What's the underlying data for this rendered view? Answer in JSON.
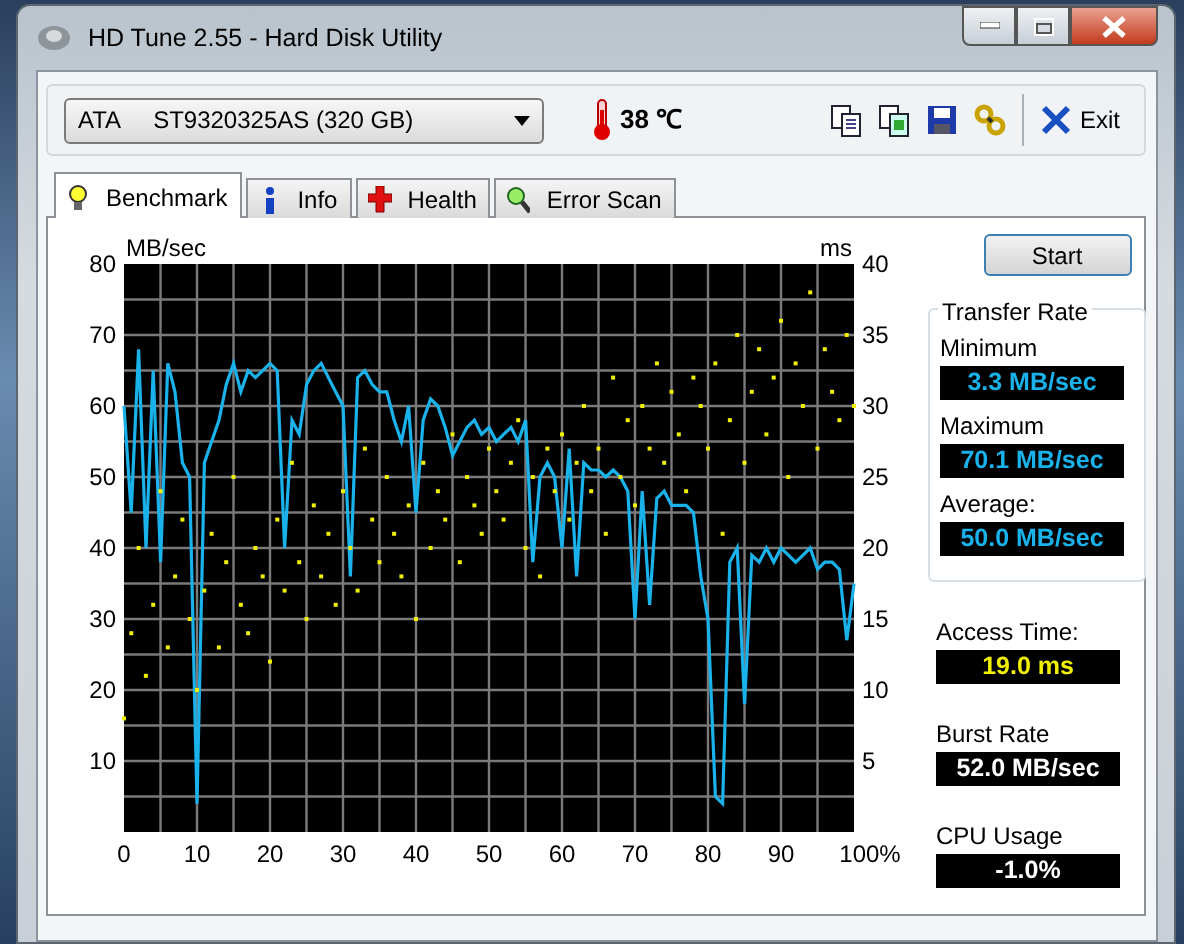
{
  "window": {
    "title": "HD Tune 2.55 - Hard Disk Utility"
  },
  "drive_select": {
    "value": "ATA     ST9320325AS (320 GB)"
  },
  "temperature": "38 ℃",
  "toolbar": [
    {
      "kind": "copy"
    },
    {
      "kind": "copy-color"
    },
    {
      "kind": "save"
    },
    {
      "kind": "options"
    },
    {
      "kind": "exit",
      "label": "Exit"
    }
  ],
  "tabs": [
    {
      "label": "Benchmark",
      "kind": "bulb",
      "selected": true
    },
    {
      "label": "Info",
      "kind": "info",
      "selected": false
    },
    {
      "label": "Health",
      "kind": "cross",
      "selected": false
    },
    {
      "label": "Error Scan",
      "kind": "magnifier",
      "selected": false
    }
  ],
  "transfer_chart": {
    "chart_data": {
      "type": "line",
      "ylabel": "MB/sec",
      "xlim": [
        0,
        100
      ],
      "ylim": [
        0,
        80
      ],
      "grid": true,
      "xticks": [
        0,
        10,
        20,
        30,
        40,
        50,
        60,
        70,
        80,
        90,
        {
          "value": 100,
          "label": "100%"
        }
      ],
      "yticks": [
        10,
        20,
        30,
        40,
        50,
        60,
        70,
        80
      ],
      "x": [
        0,
        1,
        2,
        3,
        4,
        5,
        6,
        7,
        8,
        9,
        10,
        11,
        12,
        13,
        14,
        15,
        16,
        17,
        18,
        19,
        20,
        21,
        22,
        23,
        24,
        25,
        26,
        27,
        28,
        29,
        30,
        31,
        32,
        33,
        34,
        35,
        36,
        37,
        38,
        39,
        40,
        41,
        42,
        43,
        44,
        45,
        46,
        47,
        48,
        49,
        50,
        51,
        52,
        53,
        54,
        55,
        56,
        57,
        58,
        59,
        60,
        61,
        62,
        63,
        64,
        65,
        66,
        67,
        68,
        69,
        70,
        71,
        72,
        73,
        74,
        75,
        76,
        77,
        78,
        79,
        80,
        81,
        82,
        83,
        84,
        85,
        86,
        87,
        88,
        89,
        90,
        91,
        92,
        93,
        94,
        95,
        96,
        97,
        98,
        99,
        100
      ],
      "series": [
        {
          "color": "#1ab2ea",
          "values": [
            60,
            45,
            68,
            40,
            65,
            38,
            66,
            62,
            52,
            50,
            4,
            52,
            55,
            58,
            63,
            66,
            62,
            65,
            64,
            65,
            66,
            65,
            40,
            58,
            56,
            63,
            65,
            66,
            64,
            62,
            60,
            36,
            64,
            65,
            63,
            62,
            62,
            58,
            55,
            60,
            45,
            58,
            61,
            60,
            57,
            53,
            55,
            57,
            58,
            56,
            57,
            55,
            56,
            57,
            55,
            58,
            38,
            50,
            52,
            50,
            40,
            54,
            36,
            52,
            51,
            51,
            50,
            51,
            50,
            48,
            30,
            48,
            32,
            47,
            48,
            46,
            46,
            46,
            45,
            36,
            30,
            5,
            4,
            38,
            40,
            18,
            39,
            38,
            40,
            38,
            40,
            39,
            38,
            39,
            40,
            37,
            38,
            38,
            37,
            27,
            35
          ]
        }
      ]
    }
  },
  "access_time_chart": {
    "chart_data": {
      "type": "scatter",
      "ylabel": "ms",
      "xlim": [
        0,
        100
      ],
      "ylim": [
        0,
        40
      ],
      "yticks": [
        5,
        10,
        15,
        20,
        25,
        30,
        35,
        40
      ],
      "x": [
        0,
        1,
        2,
        3,
        4,
        5,
        6,
        7,
        8,
        9,
        10,
        11,
        12,
        13,
        14,
        15,
        16,
        17,
        18,
        19,
        20,
        21,
        22,
        23,
        24,
        25,
        26,
        27,
        28,
        29,
        30,
        31,
        32,
        33,
        34,
        35,
        36,
        37,
        38,
        39,
        40,
        41,
        42,
        43,
        44,
        45,
        46,
        47,
        48,
        49,
        50,
        51,
        52,
        53,
        54,
        55,
        56,
        57,
        58,
        59,
        60,
        61,
        62,
        63,
        64,
        65,
        66,
        67,
        68,
        69,
        70,
        71,
        72,
        73,
        74,
        75,
        76,
        77,
        78,
        79,
        80,
        81,
        82,
        83,
        84,
        85,
        86,
        87,
        88,
        89,
        90,
        91,
        92,
        93,
        94,
        95,
        96,
        97,
        98,
        99,
        100
      ],
      "series": [
        {
          "color": "#f0f000",
          "values": [
            8,
            14,
            20,
            11,
            16,
            24,
            13,
            18,
            22,
            15,
            10,
            17,
            21,
            13,
            19,
            25,
            16,
            14,
            20,
            18,
            12,
            22,
            17,
            26,
            19,
            15,
            23,
            18,
            21,
            16,
            24,
            20,
            17,
            27,
            22,
            19,
            25,
            21,
            18,
            23,
            15,
            26,
            20,
            24,
            22,
            28,
            19,
            25,
            23,
            21,
            27,
            24,
            22,
            26,
            29,
            20,
            25,
            18,
            27,
            24,
            28,
            22,
            26,
            30,
            24,
            27,
            21,
            32,
            25,
            29,
            23,
            30,
            27,
            33,
            26,
            31,
            28,
            24,
            32,
            30,
            27,
            33,
            21,
            29,
            35,
            26,
            31,
            34,
            28,
            32,
            36,
            25,
            33,
            30,
            38,
            27,
            34,
            31,
            29,
            35,
            30
          ]
        }
      ]
    }
  },
  "start_button": "Start",
  "transfer_rate": {
    "title": "Transfer Rate",
    "items": [
      {
        "label": "Minimum",
        "value": "3.3 MB/sec",
        "kind": "rate"
      },
      {
        "label": "Maximum",
        "value": "70.1 MB/sec",
        "kind": "rate"
      },
      {
        "label": "Average:",
        "value": "50.0 MB/sec",
        "kind": "rate"
      }
    ]
  },
  "readings": [
    {
      "label": "Access Time:",
      "value": "19.0 ms",
      "kind": "access"
    },
    {
      "label": "Burst Rate",
      "value": "52.0 MB/sec",
      "kind": "plain"
    },
    {
      "label": "CPU Usage",
      "value": "-1.0%",
      "kind": "plain"
    }
  ]
}
